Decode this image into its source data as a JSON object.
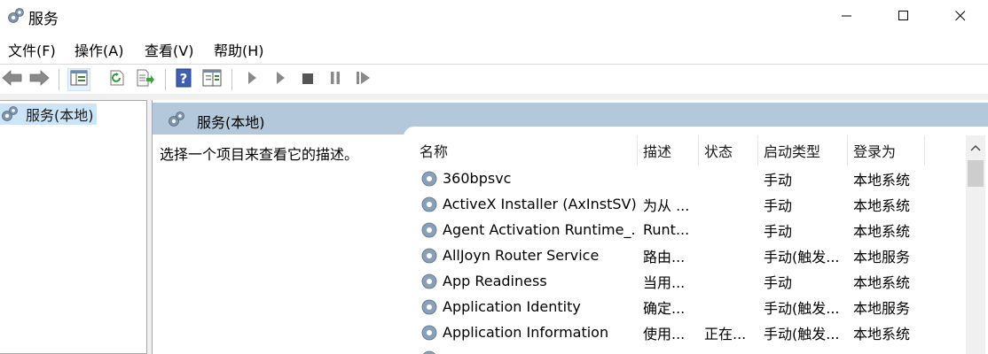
{
  "window": {
    "title": "服务",
    "app_icon": "services-gear-icon",
    "controls": {
      "minimize": "minimize-icon",
      "maximize": "maximize-icon",
      "close": "close-icon"
    }
  },
  "menu": [
    "文件(F)",
    "操作(A)",
    "查看(V)",
    "帮助(H)"
  ],
  "toolbar": {
    "buttons": [
      "back-icon",
      "forward-icon",
      "show-hide-tree-icon",
      "refresh-icon",
      "export-list-icon",
      "help-icon",
      "properties-icon",
      "start-service-icon",
      "start-service-alt-icon",
      "stop-service-icon",
      "pause-service-icon",
      "restart-service-icon"
    ]
  },
  "tree": {
    "root_label": "服务(本地)"
  },
  "content": {
    "header_label": "服务(本地)",
    "description_prompt": "选择一个项目来查看它的描述。",
    "columns": {
      "name": "名称",
      "description": "描述",
      "status": "状态",
      "startup_type": "启动类型",
      "logon_as": "登录为"
    },
    "rows": [
      {
        "name": "360bpsvc",
        "description": "",
        "status": "",
        "startup_type": "手动",
        "logon_as": "本地系统"
      },
      {
        "name": "ActiveX Installer (AxInstSV)",
        "description": "为从 ...",
        "status": "",
        "startup_type": "手动",
        "logon_as": "本地系统"
      },
      {
        "name": "Agent Activation Runtime_...",
        "description": "Runt...",
        "status": "",
        "startup_type": "手动",
        "logon_as": "本地系统"
      },
      {
        "name": "AllJoyn Router Service",
        "description": "路由...",
        "status": "",
        "startup_type": "手动(触发...",
        "logon_as": "本地服务"
      },
      {
        "name": "App Readiness",
        "description": "当用...",
        "status": "",
        "startup_type": "手动",
        "logon_as": "本地系统"
      },
      {
        "name": "Application Identity",
        "description": "确定...",
        "status": "",
        "startup_type": "手动(触发...",
        "logon_as": "本地服务"
      },
      {
        "name": "Application Information",
        "description": "使用...",
        "status": "正在...",
        "startup_type": "手动(触发...",
        "logon_as": "本地系统"
      },
      {
        "name": "",
        "description": "",
        "status": "",
        "startup_type": "",
        "logon_as": ""
      }
    ]
  },
  "colors": {
    "header_bg": "#b4c8dc",
    "selection": "#cce4f7"
  }
}
